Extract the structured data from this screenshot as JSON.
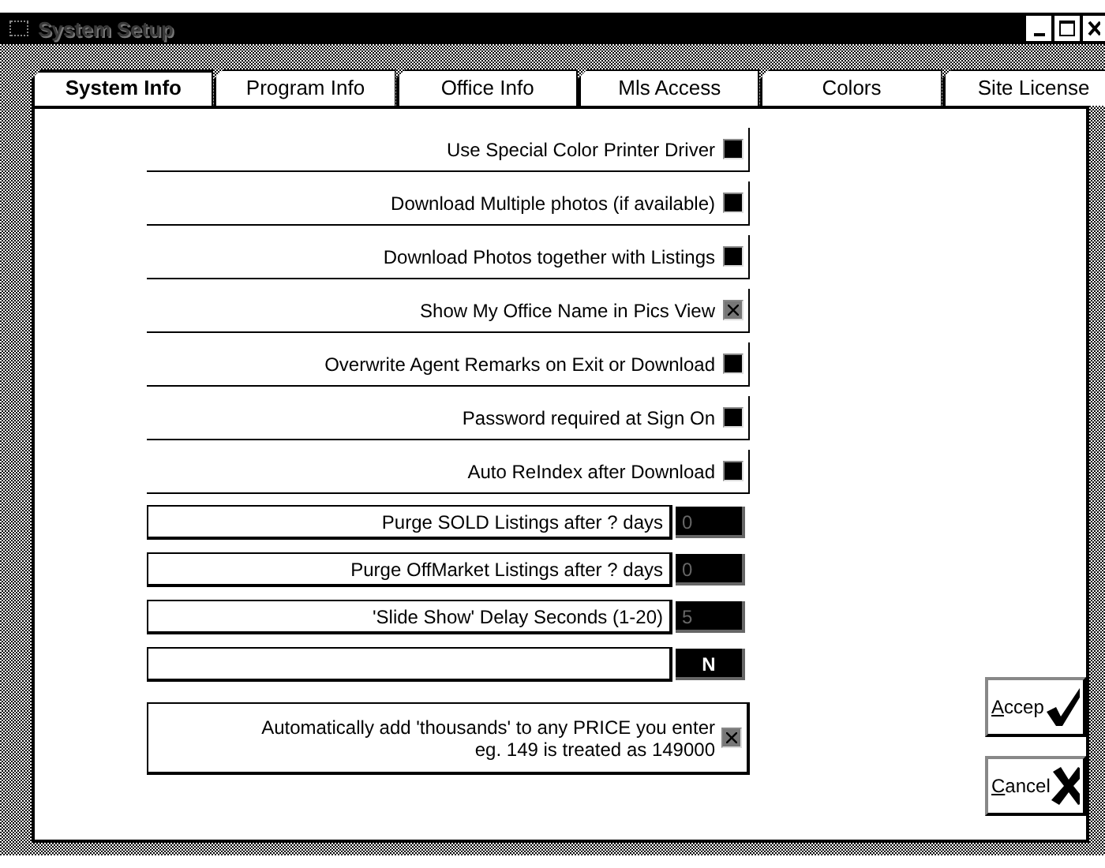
{
  "window": {
    "title": "System Setup"
  },
  "tabs": [
    {
      "label": "System Info",
      "selected": true
    },
    {
      "label": "Program Info",
      "selected": false
    },
    {
      "label": "Office Info",
      "selected": false
    },
    {
      "label": "Mls Access",
      "selected": false
    },
    {
      "label": "Colors",
      "selected": false
    },
    {
      "label": "Site License",
      "selected": false
    }
  ],
  "rows": [
    {
      "kind": "check",
      "label": "Use Special Color Printer Driver",
      "checked": false
    },
    {
      "kind": "check",
      "label": "Download Multiple photos (if available)",
      "checked": false
    },
    {
      "kind": "check",
      "label": "Download Photos together with Listings",
      "checked": false
    },
    {
      "kind": "check",
      "label": "Show My Office Name in Pics View",
      "checked": true
    },
    {
      "kind": "check",
      "label": "Overwrite Agent Remarks on Exit or Download",
      "checked": false
    },
    {
      "kind": "check",
      "label": "Password required at Sign On",
      "checked": false
    },
    {
      "kind": "check",
      "label": "Auto ReIndex after Download",
      "checked": false
    },
    {
      "kind": "field",
      "label": "Purge SOLD Listings after ? days",
      "value": "0"
    },
    {
      "kind": "field",
      "label": "Purge OffMarket Listings after ? days",
      "value": "0"
    },
    {
      "kind": "field",
      "label": "'Slide Show' Delay Seconds (1-20)",
      "value": "5"
    },
    {
      "kind": "flag",
      "value": "N"
    },
    {
      "kind": "boxcheck",
      "lines": [
        "Automatically add 'thousands' to any PRICE you enter",
        "eg. 149 is treated as 149000"
      ],
      "checked": true
    }
  ],
  "buttons": [
    {
      "kind": "accept",
      "label": "Accep"
    },
    {
      "kind": "cancel",
      "label": "Cancel"
    }
  ]
}
